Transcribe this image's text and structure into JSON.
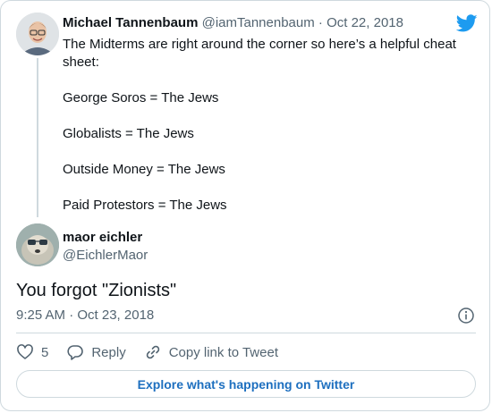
{
  "colors": {
    "accent": "#1d9bf0",
    "text": "#0f1419",
    "muted": "#536471",
    "border": "#cfd9de",
    "link": "#1d6fbf"
  },
  "parent_tweet": {
    "author_name": "Michael Tannenbaum",
    "handle": "@iamTannenbaum",
    "separator": "·",
    "date": "Oct 22, 2018",
    "text_lines": [
      "The Midterms are right around the corner so here’s a helpful cheat sheet:",
      "George Soros = The Jews",
      "Globalists = The Jews",
      "Outside Money = The Jews",
      "Paid Protestors = The Jews"
    ],
    "logo_icon": "twitter-bird-icon"
  },
  "reply_tweet": {
    "author_name": "maor eichler",
    "handle": "@EichlerMaor",
    "text": "You forgot \"Zionists\"",
    "timestamp": "9:25 AM · Oct 23, 2018",
    "info_icon": "info-icon"
  },
  "actions": {
    "like_count": "5",
    "reply_label": "Reply",
    "copy_link_label": "Copy link to Tweet"
  },
  "explore_button": {
    "label": "Explore what's happening on Twitter"
  }
}
